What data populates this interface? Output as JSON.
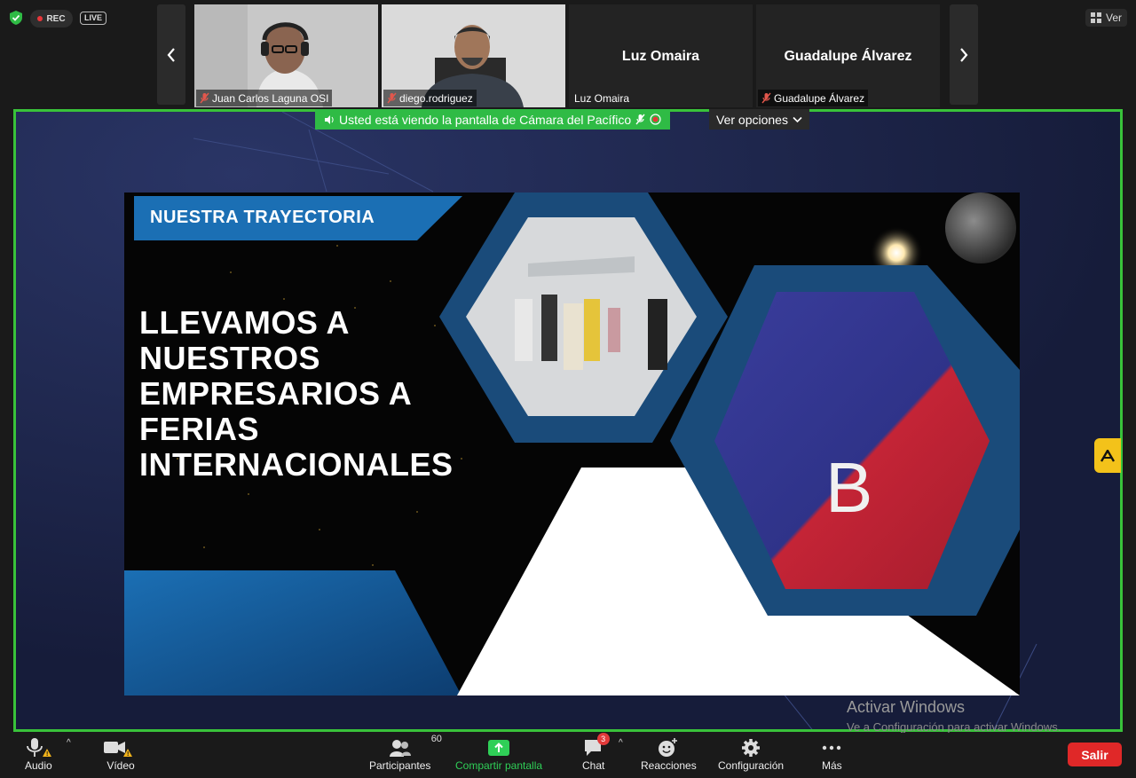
{
  "top": {
    "rec_label": "REC",
    "live_label": "LIVE",
    "view_label": "Ver"
  },
  "participants": [
    {
      "name": "Juan Carlos Laguna OSI",
      "muted": true,
      "video": true
    },
    {
      "name": "diego.rodriguez",
      "muted": true,
      "video": true
    },
    {
      "name": "Luz Omaira",
      "big_name": "Luz Omaira",
      "muted": false,
      "video": false
    },
    {
      "name": "Guadalupe Álvarez",
      "big_name": "Guadalupe Álvarez",
      "muted": true,
      "video": false
    }
  ],
  "share": {
    "banner": "Usted está viendo la pantalla de Cámara del Pacífico",
    "options_label": "Ver opciones"
  },
  "slide": {
    "title": "NUESTRA TRAYECTORIA",
    "lines": [
      "LLEVAMOS A",
      "NUESTROS",
      "EMPRESARIOS A",
      "FERIAS",
      "INTERNACIONALES"
    ],
    "sign_letter": "B"
  },
  "watermark": {
    "line1": "Activar Windows",
    "line2": "Ve a Configuración para activar Windows."
  },
  "toolbar": {
    "audio": "Audio",
    "video": "Vídeo",
    "participants": "Participantes",
    "participants_count": "60",
    "share": "Compartir pantalla",
    "chat": "Chat",
    "chat_count": "3",
    "reactions": "Reacciones",
    "settings": "Configuración",
    "more": "Más",
    "leave": "Salir"
  },
  "colors": {
    "share_border": "#39c23a",
    "banner": "#2fbb45",
    "leave": "#e02828",
    "slide_blue": "#1f6fb0"
  }
}
